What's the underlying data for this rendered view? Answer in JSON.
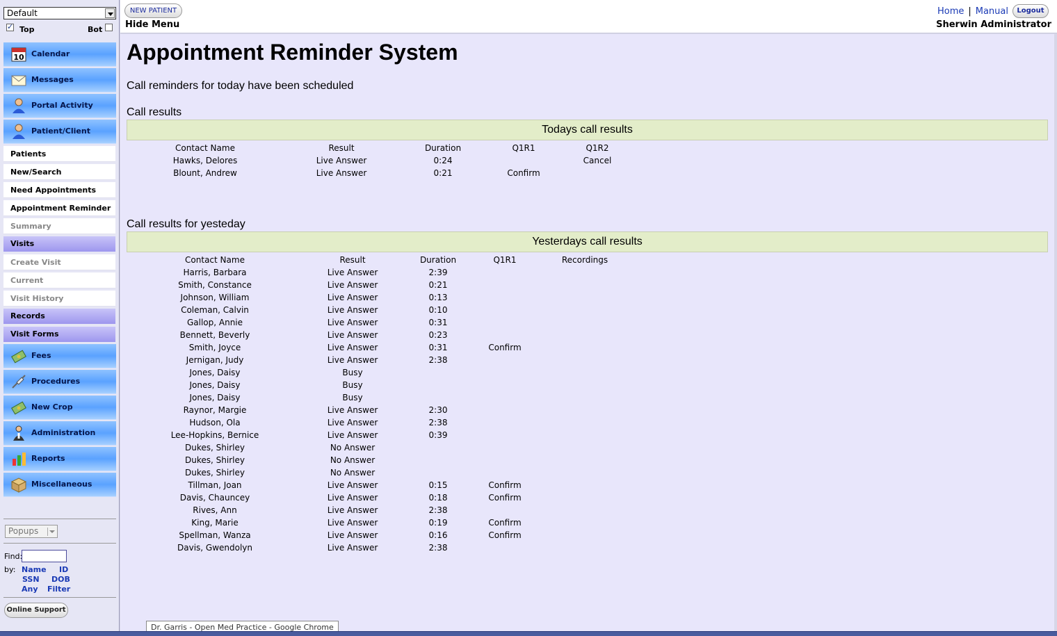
{
  "sidebar": {
    "profile": "Default",
    "top_label": "Top",
    "bot_label": "Bot",
    "nav_top": [
      {
        "label": "Calendar",
        "icon": "calendar-icon"
      },
      {
        "label": "Messages",
        "icon": "envelope-icon"
      },
      {
        "label": "Portal Activity",
        "icon": "person-icon"
      },
      {
        "label": "Patient/Client",
        "icon": "person-icon"
      }
    ],
    "patient_items": [
      "Patients",
      "New/Search",
      "Need Appointments",
      "Appointment Reminder",
      "Summary"
    ],
    "visits_label": "Visits",
    "visit_items": [
      "Create Visit",
      "Current",
      "Visit History"
    ],
    "records_label": "Records",
    "visit_forms_label": "Visit Forms",
    "nav_bottom": [
      {
        "label": "Fees",
        "icon": "money-icon"
      },
      {
        "label": "Procedures",
        "icon": "syringe-icon"
      },
      {
        "label": "New Crop",
        "icon": "money-icon"
      },
      {
        "label": "Administration",
        "icon": "admin-icon"
      },
      {
        "label": "Reports",
        "icon": "chart-icon"
      },
      {
        "label": "Miscellaneous",
        "icon": "box-icon"
      }
    ],
    "popups": "Popups",
    "find_label": "Find:",
    "by_label": "by:",
    "find_links": [
      "Name",
      "ID",
      "SSN",
      "DOB",
      "Any",
      "Filter"
    ],
    "online_support": "Online Support"
  },
  "header": {
    "new_patient": "NEW PATIENT",
    "hide_menu": "Hide Menu",
    "home": "Home",
    "manual": "Manual",
    "logout": "Logout",
    "user": "Sherwin Administrator"
  },
  "main": {
    "title": "Appointment Reminder System",
    "scheduled_msg": "Call reminders for today have been scheduled",
    "today": {
      "heading": "Call results",
      "banner": "Todays call results",
      "columns": [
        "Contact Name",
        "Result",
        "Duration",
        "Q1R1",
        "Q1R2"
      ],
      "rows": [
        [
          "Hawks, Delores",
          "Live Answer",
          "0:24",
          "",
          "Cancel"
        ],
        [
          "Blount, Andrew",
          "Live Answer",
          "0:21",
          "Confirm",
          ""
        ]
      ]
    },
    "yesterday": {
      "heading": "Call results for yesteday",
      "banner": "Yesterdays call results",
      "columns": [
        "Contact Name",
        "Result",
        "Duration",
        "Q1R1",
        "Recordings"
      ],
      "rows": [
        [
          "Harris, Barbara",
          "Live Answer",
          "2:39",
          "",
          ""
        ],
        [
          "Smith, Constance",
          "Live Answer",
          "0:21",
          "",
          ""
        ],
        [
          "Johnson, William",
          "Live Answer",
          "0:13",
          "",
          ""
        ],
        [
          "Coleman, Calvin",
          "Live Answer",
          "0:10",
          "",
          ""
        ],
        [
          "Gallop, Annie",
          "Live Answer",
          "0:31",
          "",
          ""
        ],
        [
          "Bennett, Beverly",
          "Live Answer",
          "0:23",
          "",
          ""
        ],
        [
          "Smith, Joyce",
          "Live Answer",
          "0:31",
          "Confirm",
          ""
        ],
        [
          "Jernigan, Judy",
          "Live Answer",
          "2:38",
          "",
          ""
        ],
        [
          "Jones, Daisy",
          "Busy",
          "",
          "",
          ""
        ],
        [
          "Jones, Daisy",
          "Busy",
          "",
          "",
          ""
        ],
        [
          "Jones, Daisy",
          "Busy",
          "",
          "",
          ""
        ],
        [
          "Raynor, Margie",
          "Live Answer",
          "2:30",
          "",
          ""
        ],
        [
          "Hudson, Ola",
          "Live Answer",
          "2:38",
          "",
          ""
        ],
        [
          "Lee-Hopkins, Bernice",
          "Live Answer",
          "0:39",
          "",
          ""
        ],
        [
          "Dukes, Shirley",
          "No Answer",
          "",
          "",
          ""
        ],
        [
          "Dukes, Shirley",
          "No Answer",
          "",
          "",
          ""
        ],
        [
          "Dukes, Shirley",
          "No Answer",
          "",
          "",
          ""
        ],
        [
          "Tillman, Joan",
          "Live Answer",
          "0:15",
          "Confirm",
          ""
        ],
        [
          "Davis, Chauncey",
          "Live Answer",
          "0:18",
          "Confirm",
          ""
        ],
        [
          "Rives, Ann",
          "Live Answer",
          "2:38",
          "",
          ""
        ],
        [
          "King, Marie",
          "Live Answer",
          "0:19",
          "Confirm",
          ""
        ],
        [
          "Spellman, Wanza",
          "Live Answer",
          "0:16",
          "Confirm",
          ""
        ],
        [
          "Davis, Gwendolyn",
          "Live Answer",
          "2:38",
          "",
          ""
        ]
      ]
    }
  },
  "taskbar_tooltip": "Dr. Garris - Open Med Practice - Google Chrome"
}
